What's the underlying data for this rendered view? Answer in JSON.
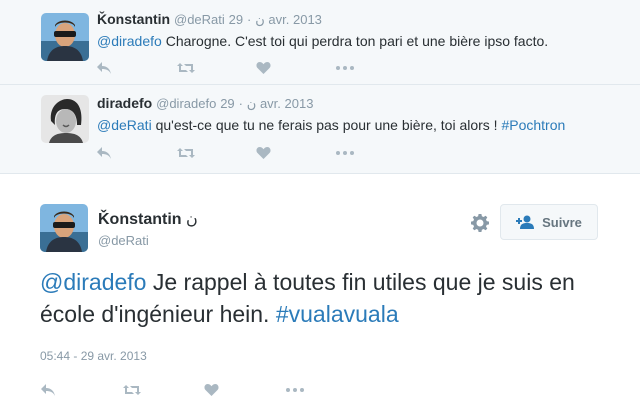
{
  "thread": [
    {
      "name": "Ǩonstantin",
      "handle": "@deRati",
      "separator": "·",
      "date": "29 avr. 2013",
      "badge": "ن",
      "text_link": "@diradefo",
      "text_rest": " Charogne. C'est toi qui perdra ton pari et une bière ipso facto.",
      "hashtag": ""
    },
    {
      "name": "diradefo",
      "handle": "@diradefo",
      "separator": "·",
      "date": "29 avr. 2013",
      "badge": "ن",
      "text_link": "@deRati",
      "text_rest": " qu'est-ce que tu ne ferais pas pour une bière, toi alors ! ",
      "hashtag": "#Pochtron"
    }
  ],
  "main_tweet": {
    "name": "Ǩonstantin",
    "badge": "ن",
    "handle": "@deRati",
    "follow_label": "Suivre",
    "text_mention": "@diradefo",
    "text_body": " Je rappel à toutes fin utiles que je suis en école d'ingénieur hein. ",
    "text_hashtag": "#vualavuala",
    "timestamp": "05:44 - 29 avr. 2013"
  },
  "icons": [
    "reply-icon",
    "retweet-icon",
    "favorite-icon",
    "more-icon",
    "gear-icon",
    "follow-icon"
  ],
  "colors": {
    "link": "#2b7bb9",
    "muted": "#8899a6",
    "icon": "#aab8c2",
    "context_bg": "#f5f8fa",
    "border": "#e1e8ed"
  }
}
